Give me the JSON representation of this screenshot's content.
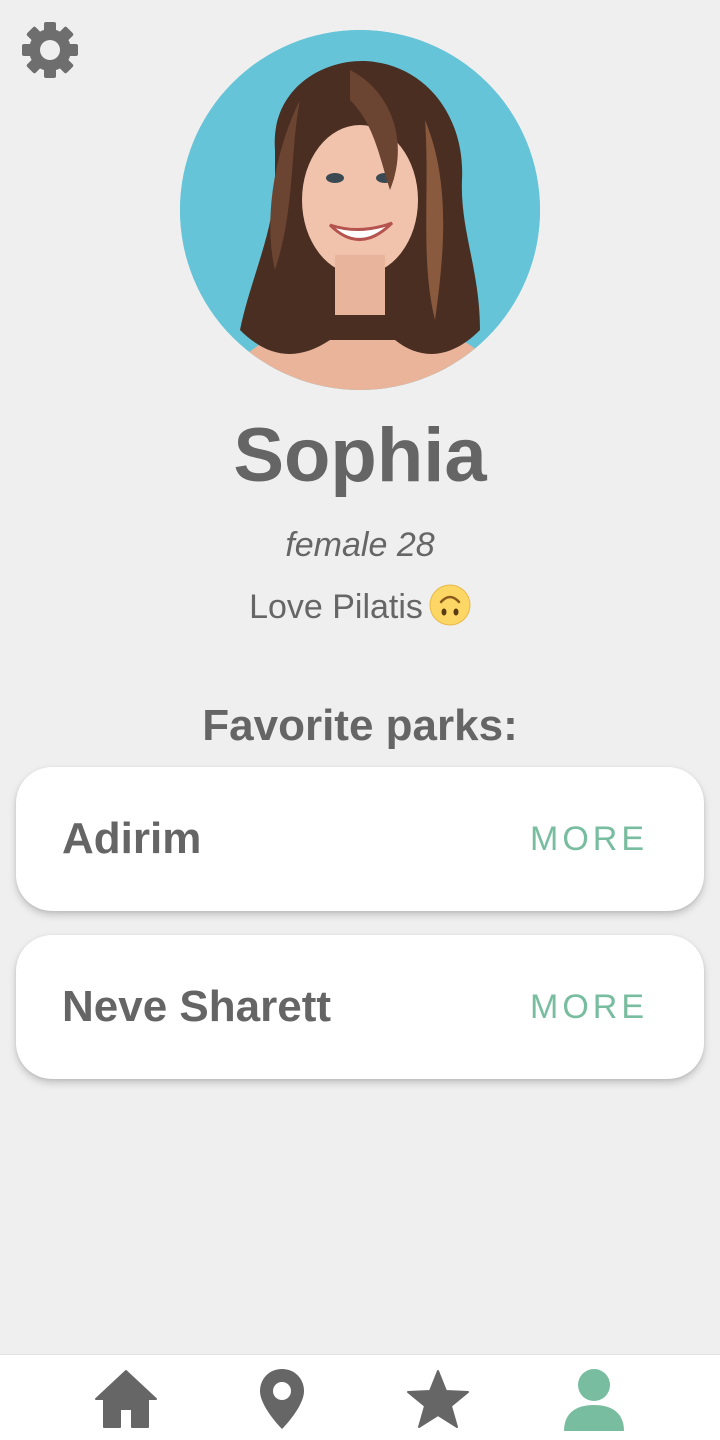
{
  "profile": {
    "name": "Sophia",
    "meta": "female 28",
    "bio": "Love Pilatis",
    "bio_emoji": "upside-down-face-emoji"
  },
  "favorites": {
    "title": "Favorite parks:",
    "parks": [
      {
        "name": "Adirim",
        "action": "MORE"
      },
      {
        "name": "Neve Sharett",
        "action": "MORE"
      }
    ]
  },
  "nav": {
    "items": [
      {
        "icon": "home-icon",
        "active": false
      },
      {
        "icon": "map-pin-icon",
        "active": false
      },
      {
        "icon": "star-icon",
        "active": false
      },
      {
        "icon": "person-icon",
        "active": true
      }
    ]
  },
  "colors": {
    "background": "#efefef",
    "text": "#656565",
    "accent": "#78bd9f",
    "card": "#ffffff",
    "avatar_bg": "#66c4d8"
  },
  "icons": {
    "settings": "gear-icon"
  }
}
